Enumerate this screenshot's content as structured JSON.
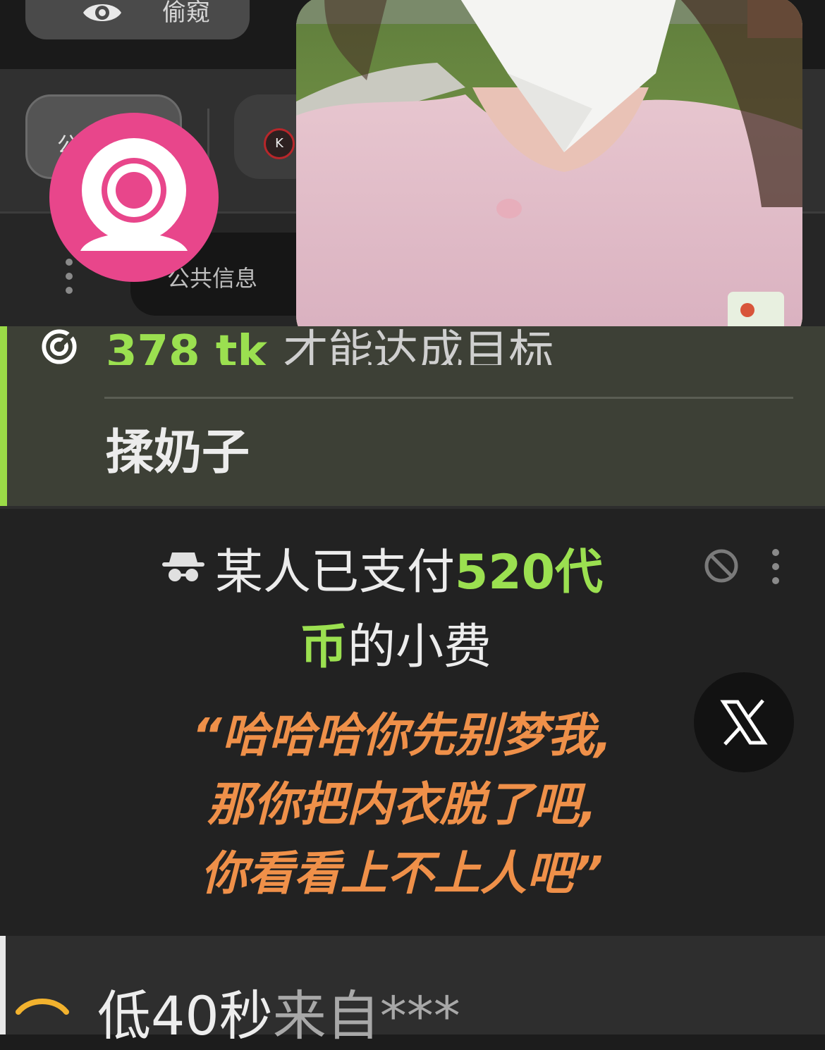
{
  "header": {
    "spy_label": "偷窥"
  },
  "tabs": {
    "public_label": "公",
    "private_avatar_letter": "K"
  },
  "info_tab": {
    "label": "公共信息"
  },
  "goal": {
    "amount": "378 tk",
    "rest": "才能达成目标",
    "label": "揉奶子"
  },
  "tip": {
    "prefix": "某人已支付",
    "amount_part1": "520代",
    "amount_part2": "币",
    "suffix": "的小费",
    "quote_lines": [
      "“哈哈哈你先别梦我,",
      "那你把内衣脱了吧,",
      "你看看上不上人吧”"
    ]
  },
  "bottom": {
    "text_main": "低40秒",
    "text_sub": "来自***"
  },
  "colors": {
    "accent_green": "#9be050",
    "quote_orange": "#ef9049",
    "webcam_pink": "#e8468b",
    "private_ring_red": "#b8262a"
  },
  "icons": [
    "eye-icon",
    "webcam-icon",
    "more-vert-icon",
    "target-icon",
    "anonymous-icon",
    "ban-icon",
    "x-logo-icon",
    "chevron-up-icon"
  ]
}
